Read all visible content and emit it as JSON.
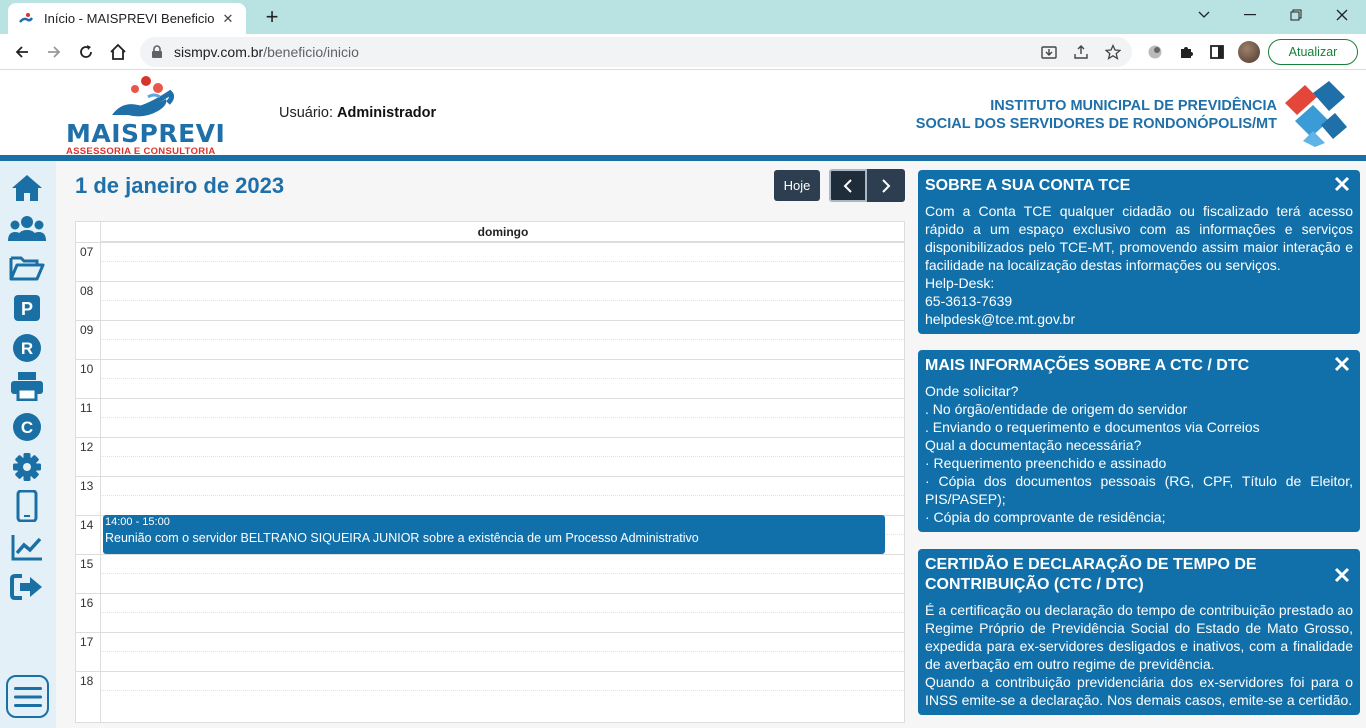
{
  "browser": {
    "tab_title": "Início - MAISPREVI Beneficio",
    "url_host": "sismpv.com.br",
    "url_path": "/beneficio/inicio",
    "update_label": "Atualizar"
  },
  "header": {
    "logo_name": "MAISPREVI",
    "logo_tagline": "ASSESSORIA E CONSULTORIA",
    "user_prefix": "Usuário:",
    "user_name": "Administrador",
    "institute_line1": "INSTITUTO MUNICIPAL DE PREVIDÊNCIA",
    "institute_line2": "SOCIAL DOS SERVIDORES DE RONDONÓPOLIS/MT"
  },
  "sidebar": {
    "icons": [
      "home-icon",
      "users-icon",
      "folder-open-icon",
      "p-letter-icon",
      "r-letter-icon",
      "print-icon",
      "c-letter-icon",
      "gear-icon",
      "mobile-icon",
      "chart-line-icon",
      "sign-out-icon"
    ],
    "menu_icon": "hamburger-icon"
  },
  "calendar": {
    "title": "1 de janeiro de 2023",
    "today_label": "Hoje",
    "day_header": "domingo",
    "hours": [
      "07",
      "08",
      "09",
      "10",
      "11",
      "12",
      "13",
      "14",
      "15",
      "16",
      "17",
      "18"
    ],
    "event": {
      "time": "14:00 - 15:00",
      "title": "Reunião com o servidor BELTRANO SIQUEIRA JUNIOR sobre a existência de um Processo Administrativo"
    }
  },
  "cards": [
    {
      "title": "SOBRE A SUA CONTA TCE",
      "lines": [
        "Com a Conta TCE qualquer cidadão ou fiscalizado terá acesso rápido a um espaço exclusivo com as informações e serviços disponibilizados pelo TCE-MT, promovendo assim maior interação e facilidade na localização destas informações ou serviços.",
        "Help-Desk:",
        "65-3613-7639",
        "helpdesk@tce.mt.gov.br"
      ]
    },
    {
      "title": "MAIS INFORMAÇÕES SOBRE A CTC / DTC",
      "lines": [
        "Onde solicitar?",
        ". No órgão/entidade de origem do servidor",
        ". Enviando o requerimento e documentos via Correios",
        "Qual a documentação necessária?",
        "· Requerimento preenchido e assinado",
        "· Cópia dos documentos pessoais (RG, CPF, Título de Eleitor, PIS/PASEP);",
        "· Cópia do comprovante de residência;"
      ]
    },
    {
      "title": "CERTIDÃO E DECLARAÇÃO DE TEMPO DE CONTRIBUIÇÃO (CTC / DTC)",
      "lines": [
        "É a certificação ou declaração do tempo de contribuição prestado ao Regime Próprio de Previdência Social do Estado de Mato Grosso, expedida para ex-servidores desligados e inativos, com a finalidade de averbação em outro regime de previdência.",
        "Quando a contribuição previdenciária dos ex-servidores foi para o INSS emite-se a declaração. Nos demais casos, emite-se a certidão."
      ]
    }
  ],
  "colors": {
    "primary": "#1170aa",
    "brand_text": "#1f6fa8",
    "dark_button": "#2c3e50",
    "logo_red": "#d9332b"
  }
}
